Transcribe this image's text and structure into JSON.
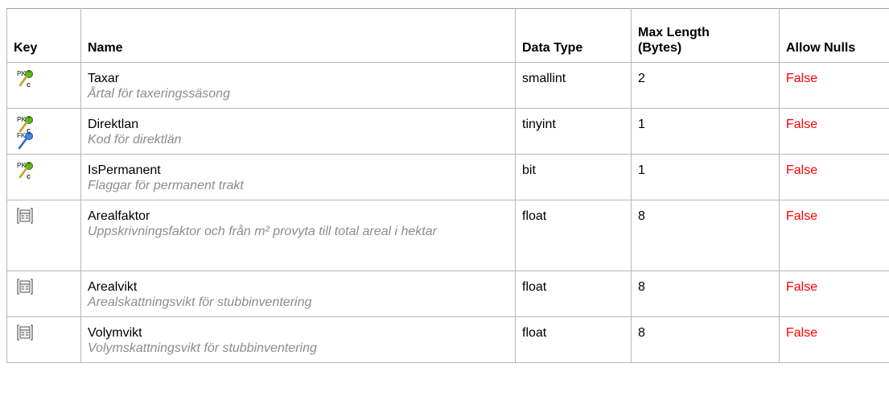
{
  "headers": {
    "key": "Key",
    "name": "Name",
    "data_type": "Data Type",
    "max_length_1": "Max Length",
    "max_length_2": "(Bytes)",
    "allow_nulls": "Allow Nulls"
  },
  "rows": [
    {
      "keys": [
        "pk-c-icon"
      ],
      "name": "Taxar",
      "description": "Årtal för taxeringssäsong",
      "data_type": "smallint",
      "max_length": "2",
      "allow_nulls": "False"
    },
    {
      "keys": [
        "pk-c-icon",
        "fk-icon"
      ],
      "name": "Direktlan",
      "description": "Kod för direktlän",
      "data_type": "tinyint",
      "max_length": "1",
      "allow_nulls": "False"
    },
    {
      "keys": [
        "pk-c-icon"
      ],
      "name": "IsPermanent",
      "description": "Flaggar för permanent trakt",
      "data_type": "bit",
      "max_length": "1",
      "allow_nulls": "False"
    },
    {
      "keys": [
        "column-icon"
      ],
      "name": "Arealfaktor",
      "description": "Uppskrivningsfaktor och från m² provyta till total areal i hektar",
      "data_type": "float",
      "max_length": "8",
      "allow_nulls": "False"
    },
    {
      "keys": [
        "column-icon"
      ],
      "name": "Arealvikt",
      "description": "Arealskattningsvikt för stubbinventering",
      "data_type": "float",
      "max_length": "8",
      "allow_nulls": "False"
    },
    {
      "keys": [
        "column-icon"
      ],
      "name": "Volymvikt",
      "description": "Volymskattningsvikt för stubbinventering",
      "data_type": "float",
      "max_length": "8",
      "allow_nulls": "False"
    }
  ],
  "colors": {
    "false_text": "#ff0000",
    "description_text": "#8c8c8c",
    "pk_key": "#4a9a1a",
    "fk_key": "#1a6ad0"
  }
}
